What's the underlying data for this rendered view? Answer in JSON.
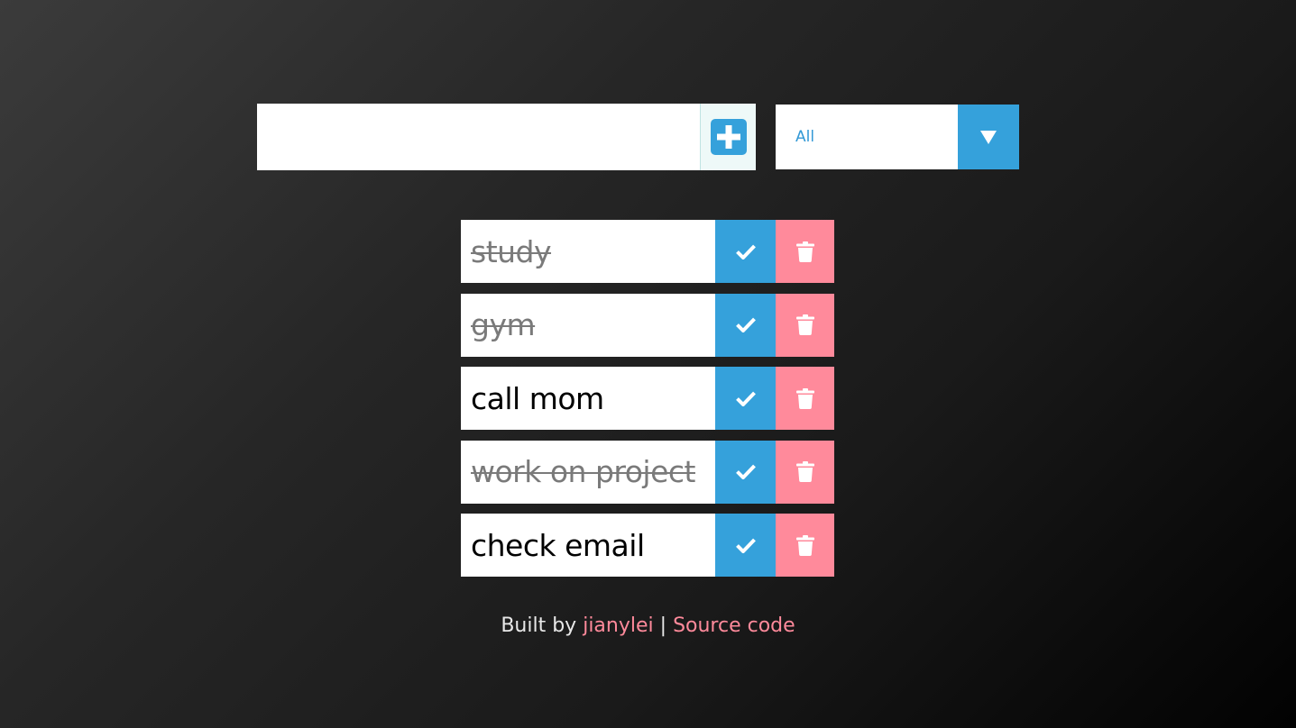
{
  "input": {
    "value": "",
    "add_icon": "plus-icon"
  },
  "filter": {
    "selected": "All",
    "arrow_icon": "caret-down-icon"
  },
  "todos": [
    {
      "text": "study",
      "completed": true
    },
    {
      "text": "gym",
      "completed": true
    },
    {
      "text": "call mom",
      "completed": false
    },
    {
      "text": "work on project",
      "completed": true
    },
    {
      "text": "check email",
      "completed": false
    }
  ],
  "footer": {
    "prefix": "Built by",
    "author": "jianylei",
    "separator": "|",
    "source": "Source code"
  },
  "colors": {
    "accent": "#35a1db",
    "delete": "#ff8a9b",
    "completed_text": "#7a7a7a"
  }
}
